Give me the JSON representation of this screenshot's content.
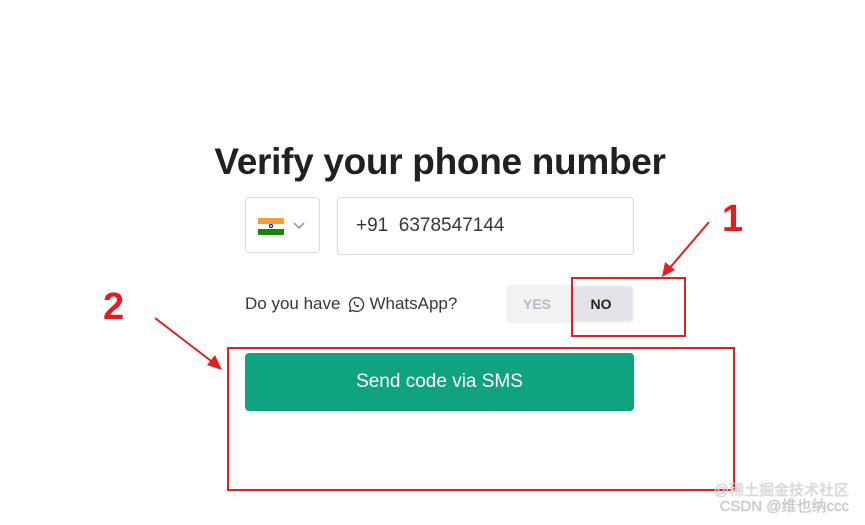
{
  "page": {
    "title": "Verify your phone number"
  },
  "phone": {
    "country_flag": "india-flag-icon",
    "value": "+91  6378547144"
  },
  "whatsapp": {
    "prompt": "Do you have",
    "app_name": "WhatsApp?",
    "yes_label": "YES",
    "no_label": "NO",
    "selected": "NO"
  },
  "actions": {
    "send_label": "Send code via SMS"
  },
  "annotations": {
    "label_1": "1",
    "label_2": "2"
  },
  "watermark": {
    "line1": "@稀土掘金技术社区",
    "line2": "CSDN @维也纳ccc"
  },
  "colors": {
    "accent": "#10a37f",
    "annotation_red": "#e02020",
    "title": "#202123"
  }
}
